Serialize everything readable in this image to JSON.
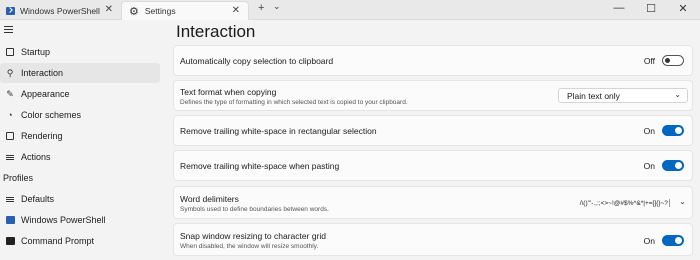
{
  "tabs": [
    {
      "label": "Windows PowerShell",
      "icon": "powershell-icon"
    },
    {
      "label": "Settings",
      "icon": "gear-icon"
    }
  ],
  "titlebar": {
    "new_tab": "+",
    "dropdown": "⌄",
    "minimize": "—",
    "maximize": "☐",
    "close": "✕"
  },
  "sidebar": {
    "items": [
      {
        "label": "Startup",
        "icon": "startup-icon"
      },
      {
        "label": "Interaction",
        "icon": "interaction-icon",
        "selected": true
      },
      {
        "label": "Appearance",
        "icon": "appearance-icon"
      },
      {
        "label": "Color schemes",
        "icon": "color-schemes-icon"
      },
      {
        "label": "Rendering",
        "icon": "rendering-icon"
      },
      {
        "label": "Actions",
        "icon": "actions-icon"
      }
    ],
    "profiles_header": "Profiles",
    "profiles": [
      {
        "label": "Defaults",
        "icon": "defaults-icon"
      },
      {
        "label": "Windows PowerShell",
        "icon": "powershell-icon"
      },
      {
        "label": "Command Prompt",
        "icon": "command-prompt-icon"
      }
    ]
  },
  "main": {
    "title": "Interaction",
    "settings": [
      {
        "title": "Automatically copy selection to clipboard",
        "control": "toggle",
        "state": "Off"
      },
      {
        "title": "Text format when copying",
        "description": "Defines the type of formatting in which selected text is copied to your clipboard.",
        "control": "dropdown",
        "value": "Plain text only"
      },
      {
        "title": "Remove trailing white-space in rectangular selection",
        "control": "toggle",
        "state": "On"
      },
      {
        "title": "Remove trailing white-space when pasting",
        "control": "toggle",
        "state": "On"
      },
      {
        "title": "Word delimiters",
        "description": "Symbols used to define boundaries between words.",
        "control": "expander",
        "value": "/\\()\"'-.,:;<>~!@#$%^&*|+=[]{}~?│"
      },
      {
        "title": "Snap window resizing to character grid",
        "description": "When disabled, the window will resize smoothly.",
        "control": "toggle",
        "state": "On"
      }
    ]
  },
  "colors": {
    "accent": "#0067c0",
    "background": "#f3f3f3",
    "card": "#fbfbfb"
  }
}
